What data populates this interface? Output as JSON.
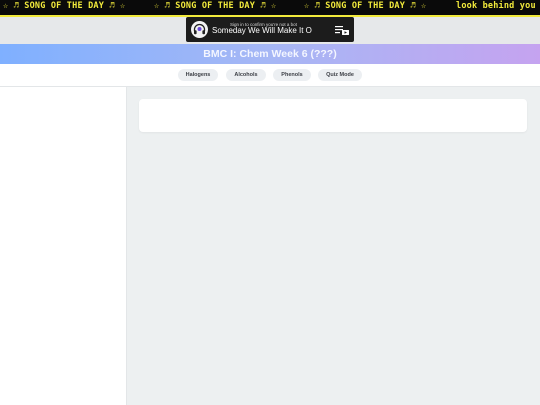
{
  "marquee": {
    "items": [
      "☆ ♬ SONG OF THE DAY ♬ ☆",
      "☆ ♬ SONG OF THE DAY ♬ ☆",
      "☆ ♬ SONG OF THE DAY ♬ ☆",
      "look behind you xD"
    ],
    "color": "#f2ea3c",
    "background": "#0a0a0a"
  },
  "video": {
    "signin_notice": "Sign in to confirm you're not a bot",
    "title": "Someday We Will Make It Outta ...",
    "thumbnail_icon": "headphones-icon",
    "playlist_icon": "playlist-icon"
  },
  "banner": {
    "title": "BMC I: Chem Week 6 (???)",
    "gradient": [
      "#7fb0ff",
      "#c5a3f0"
    ]
  },
  "tabs": [
    {
      "label": "Halogens"
    },
    {
      "label": "Alcohols"
    },
    {
      "label": "Phenols"
    },
    {
      "label": "Quiz Mode"
    }
  ]
}
